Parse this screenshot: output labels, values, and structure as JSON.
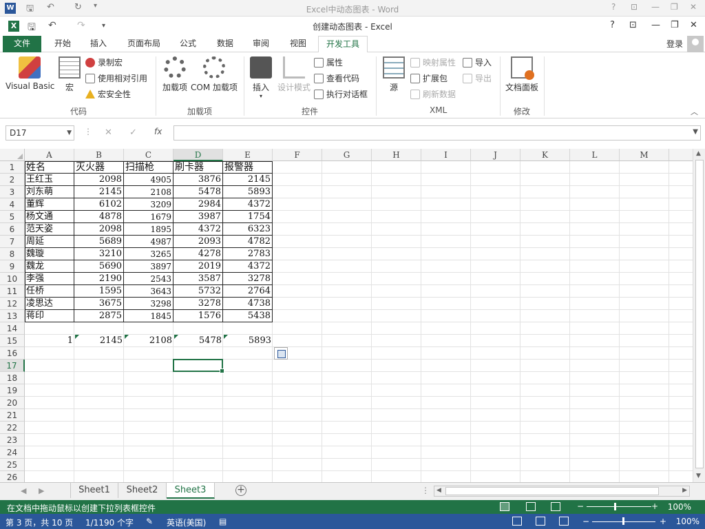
{
  "word": {
    "app_icon": "W",
    "title": "Excel中动态图表 - Word",
    "controls": [
      "?",
      "⊡",
      "—",
      "❐",
      "✕"
    ]
  },
  "excel": {
    "app_icon": "X",
    "title": "创建动态图表 - Excel",
    "controls": [
      "?",
      "⊡",
      "—",
      "❐",
      "✕"
    ]
  },
  "tabs": {
    "file": "文件",
    "items": [
      "开始",
      "插入",
      "页面布局",
      "公式",
      "数据",
      "审阅",
      "视图",
      "开发工具"
    ],
    "active": "开发工具",
    "login": "登录"
  },
  "ribbon": {
    "groups": {
      "code": {
        "label": "代码",
        "visual_basic": "Visual Basic",
        "macro": "宏",
        "record_macro": "录制宏",
        "use_relative": "使用相对引用",
        "macro_security": "宏安全性"
      },
      "addins": {
        "label": "加载项",
        "addins": "加载项",
        "com_addins": "COM 加载项"
      },
      "controls": {
        "label": "控件",
        "insert": "插入",
        "design_mode": "设计模式",
        "properties": "属性",
        "view_code": "查看代码",
        "run_dialog": "执行对话框"
      },
      "xml": {
        "label": "XML",
        "source": "源",
        "map_properties": "映射属性",
        "expansion_packs": "扩展包",
        "refresh_data": "刷新数据",
        "import": "导入",
        "export": "导出"
      },
      "modify": {
        "label": "修改",
        "document_panel": "文档面板"
      }
    }
  },
  "formula_bar": {
    "name_box": "D17",
    "fx": "fx",
    "cancel": "✕",
    "enter": "✓",
    "value": ""
  },
  "grid": {
    "columns": [
      "A",
      "B",
      "C",
      "D",
      "E",
      "F",
      "G",
      "H",
      "I",
      "J",
      "K",
      "L",
      "M"
    ],
    "selected_column": "D",
    "rows": [
      "1",
      "2",
      "3",
      "4",
      "5",
      "6",
      "7",
      "8",
      "9",
      "10",
      "11",
      "12",
      "13",
      "14",
      "15",
      "16",
      "17",
      "18",
      "19",
      "20",
      "21",
      "22",
      "23",
      "24",
      "25",
      "26"
    ],
    "selected_row": "17",
    "header": [
      "姓名",
      "灭火器",
      "扫描枪",
      "刷卡器",
      "报警器"
    ],
    "data": [
      [
        "王红玉",
        "2098",
        "4905",
        "3876",
        "2145"
      ],
      [
        "刘东萌",
        "2145",
        "2108",
        "5478",
        "5893"
      ],
      [
        "董辉",
        "6102",
        "3209",
        "2984",
        "4372"
      ],
      [
        "杨文通",
        "4878",
        "1679",
        "3987",
        "1754"
      ],
      [
        "范天姿",
        "2098",
        "1895",
        "4372",
        "6323"
      ],
      [
        "周延",
        "5689",
        "4987",
        "2093",
        "4782"
      ],
      [
        "魏璇",
        "3210",
        "3265",
        "4278",
        "2783"
      ],
      [
        "魏龙",
        "5690",
        "3897",
        "2019",
        "4372"
      ],
      [
        "李强",
        "2190",
        "2543",
        "3587",
        "3278"
      ],
      [
        "任桥",
        "1595",
        "3643",
        "5732",
        "2764"
      ],
      [
        "凌思达",
        "3675",
        "3298",
        "3278",
        "4738"
      ],
      [
        "蒋印",
        "2875",
        "1845",
        "1576",
        "5438"
      ]
    ],
    "row15": [
      "1",
      "2145",
      "2108",
      "5478",
      "5893"
    ]
  },
  "sheets": {
    "tabs": [
      "Sheet1",
      "Sheet2",
      "Sheet3"
    ],
    "active": "Sheet3",
    "add": "+"
  },
  "excel_status": {
    "message": "在文档中拖动鼠标以创建下拉列表框控件",
    "zoom": "100%"
  },
  "word_status": {
    "page": "第 3 页，共 10 页",
    "words": "1/1190 个字",
    "language": "英语(美国)",
    "zoom": "100%"
  }
}
